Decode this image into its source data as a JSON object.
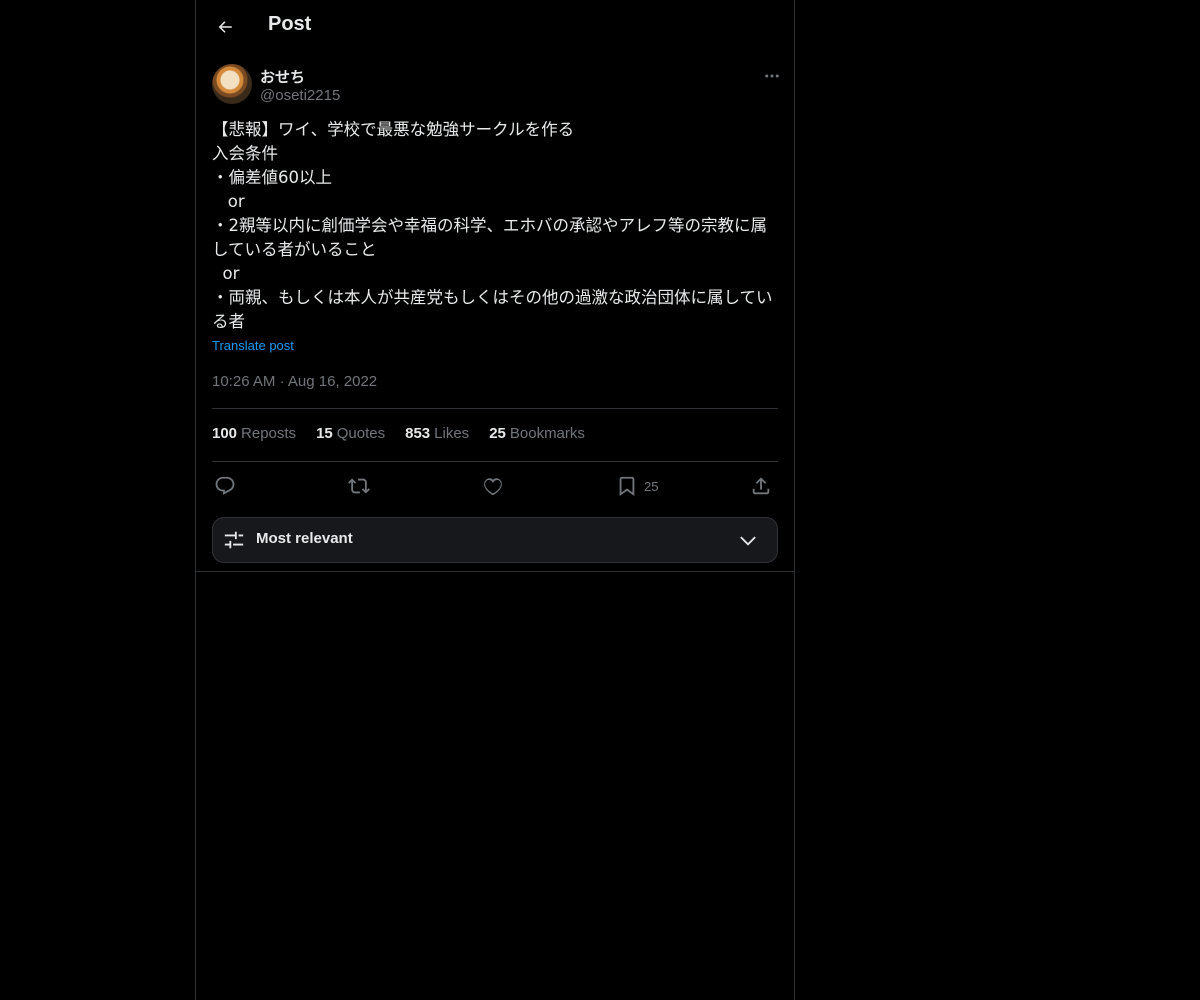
{
  "header": {
    "title": "Post"
  },
  "post": {
    "author": {
      "display_name": "おせち",
      "handle": "@oseti2215"
    },
    "text": "【悲報】ワイ、学校で最悪な勉強サークルを作る\n入会条件\n・偏差値60以上\n   or\n・2親等以内に創価学会や幸福の科学、エホバの承認やアレフ等の宗教に属している者がいること\n  or\n・両親、もしくは本人が共産党もしくはその他の過激な政治団体に属している者",
    "translate_label": "Translate post",
    "time": "10:26 AM",
    "separator": "·",
    "date": "Aug 16, 2022"
  },
  "stats": {
    "reposts": {
      "count": "100",
      "label": "Reposts"
    },
    "quotes": {
      "count": "15",
      "label": "Quotes"
    },
    "likes": {
      "count": "853",
      "label": "Likes"
    },
    "bookmarks": {
      "count": "25",
      "label": "Bookmarks"
    }
  },
  "actions": {
    "bookmark_count": "25"
  },
  "replies_sort": {
    "label": "Most relevant"
  },
  "colors": {
    "background": "#000000",
    "text": "#e7e9ea",
    "muted": "#71767b",
    "link": "#1d9bf0",
    "border": "#2f3336"
  },
  "icons": [
    "back-arrow-icon",
    "more-icon",
    "reply-icon",
    "repost-icon",
    "like-icon",
    "bookmark-icon",
    "share-icon",
    "sort-sliders-icon",
    "chevron-down-icon"
  ]
}
